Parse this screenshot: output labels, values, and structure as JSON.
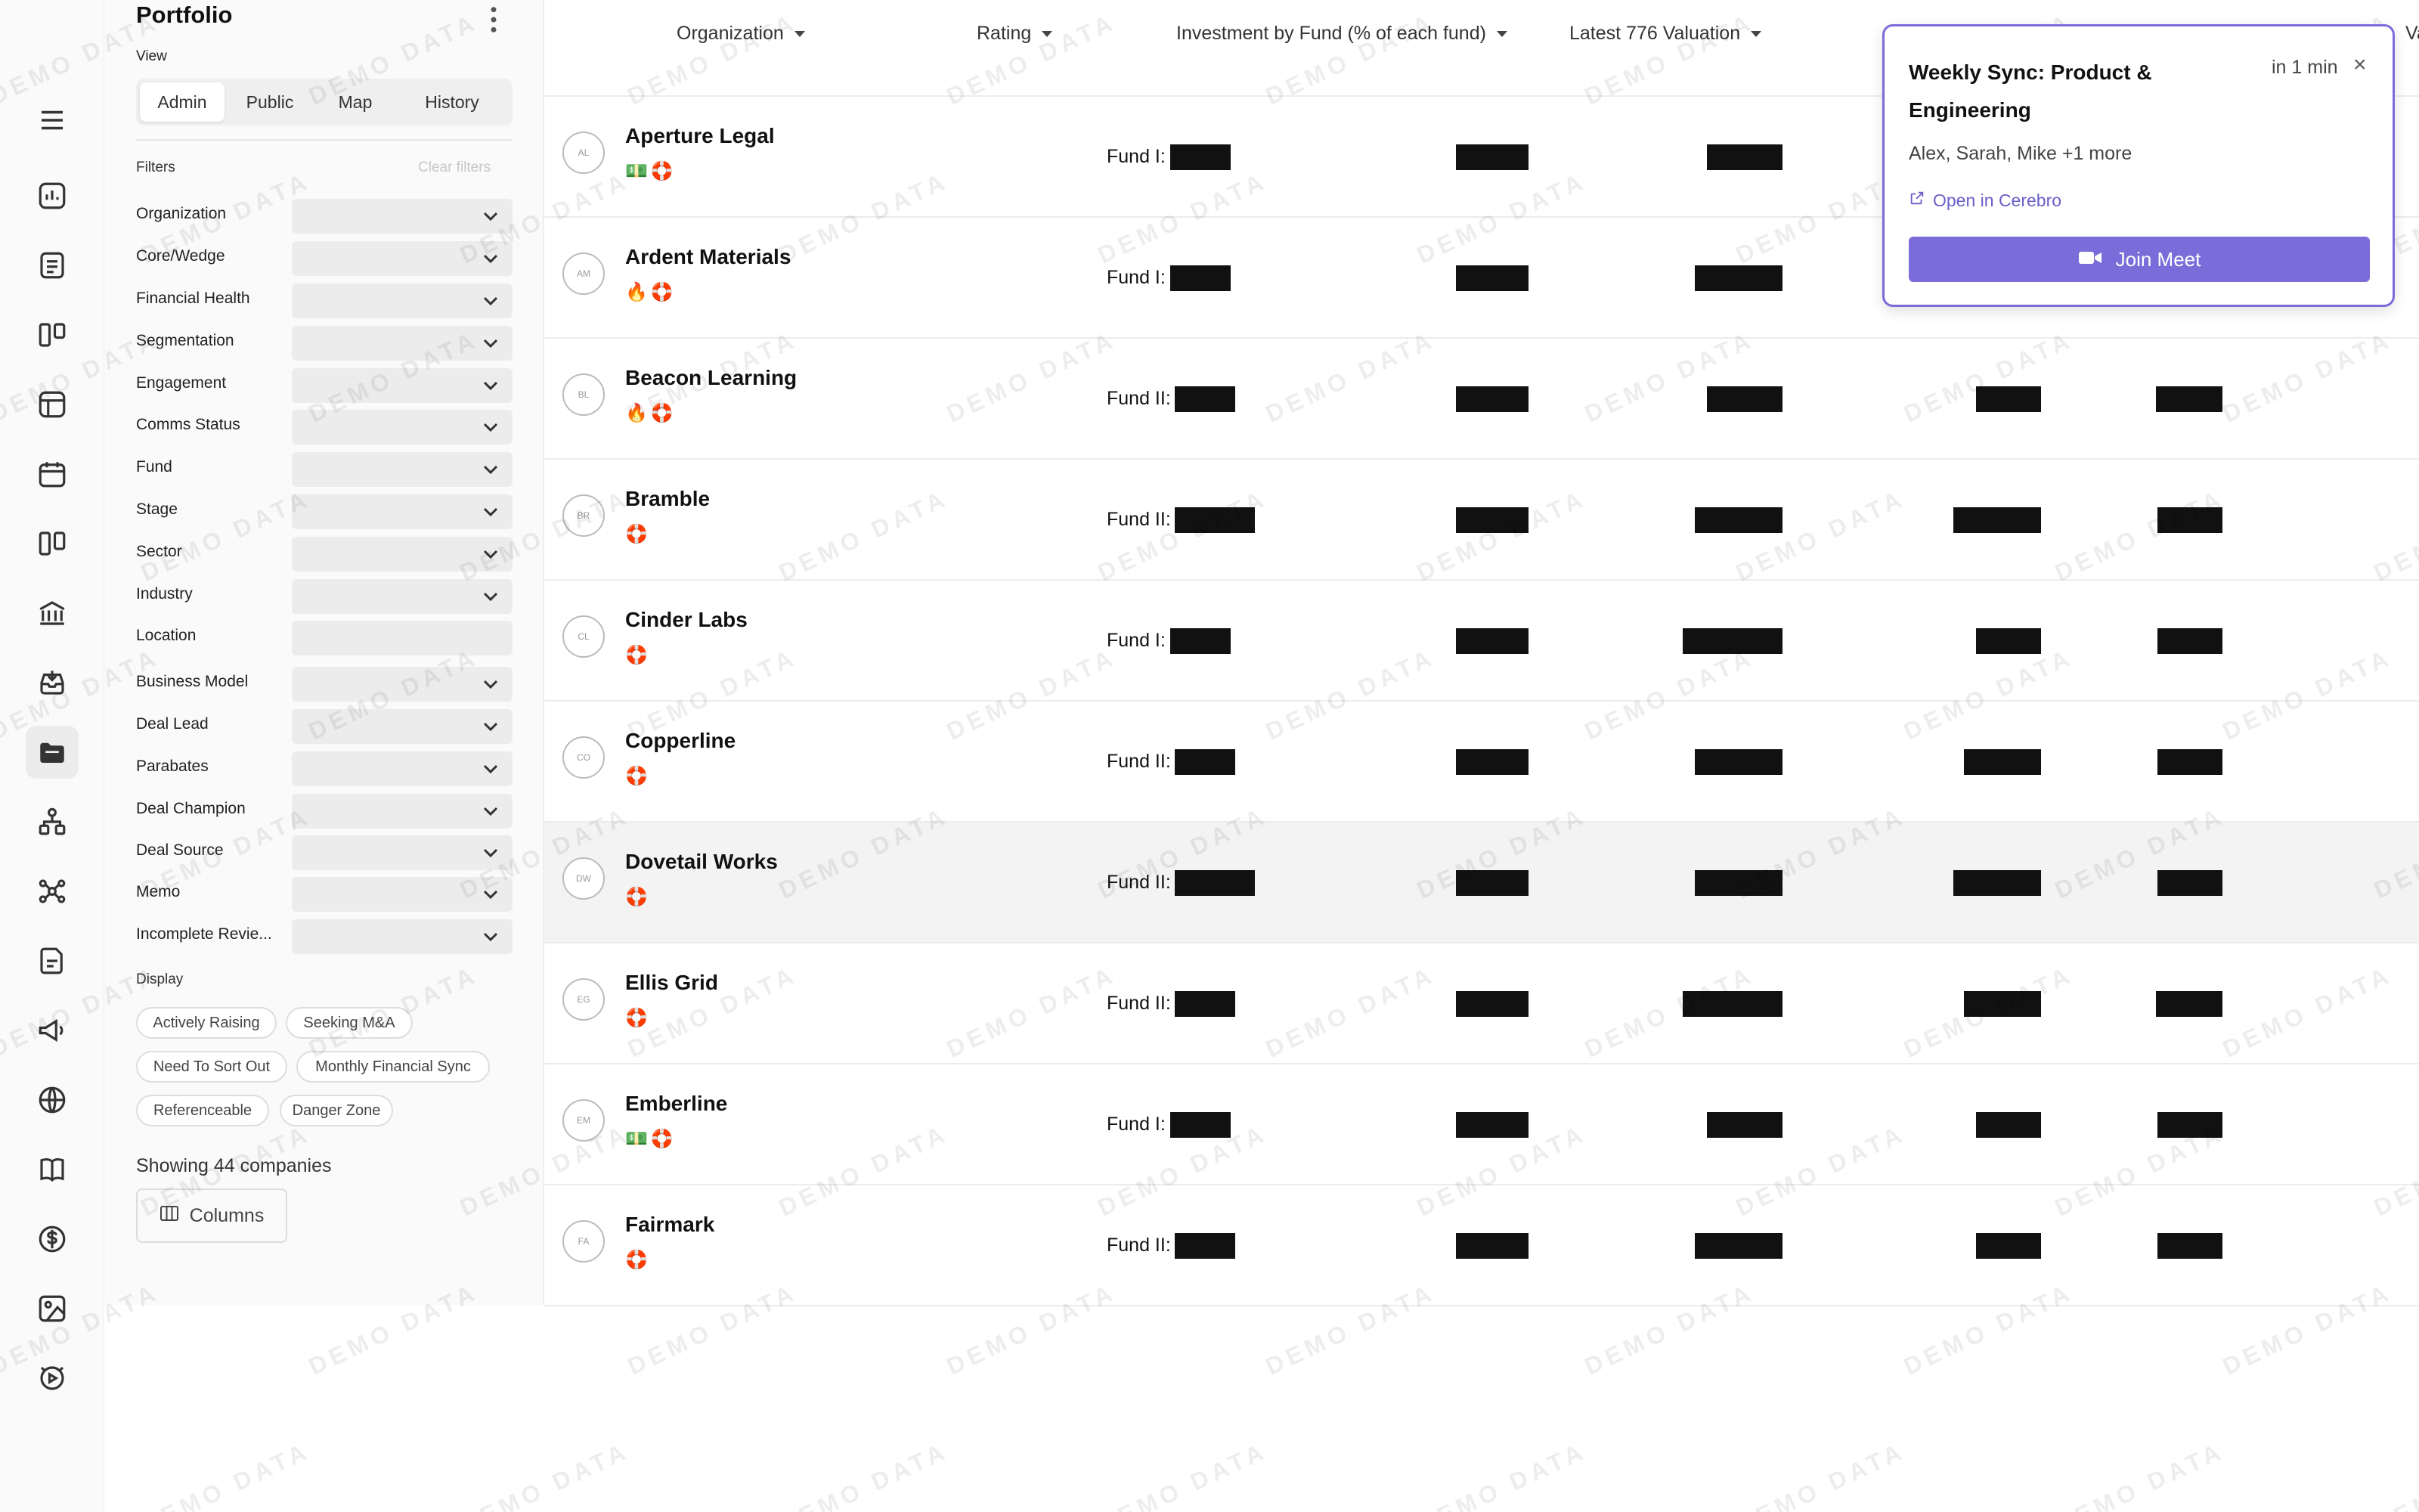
{
  "sidebar": {
    "title": "Portfolio",
    "view_label": "View",
    "views": [
      "Admin",
      "Public",
      "Map",
      "History"
    ],
    "active_view": "Admin",
    "filters_label": "Filters",
    "clear_filters": "Clear filters",
    "filters": [
      "Organization",
      "Core/Wedge",
      "Financial Health",
      "Segmentation",
      "Engagement",
      "Comms Status",
      "Fund",
      "Stage",
      "Sector",
      "Industry",
      "Location",
      "Business Model",
      "Deal Lead",
      "Parabates",
      "Deal Champion",
      "Deal Source",
      "Memo",
      "Incomplete Revie..."
    ],
    "display_label": "Display",
    "display_chips": [
      "Actively Raising",
      "Seeking M&A",
      "Need To Sort Out",
      "Monthly Financial Sync",
      "Referenceable",
      "Danger Zone"
    ],
    "showing": "Showing 44 companies",
    "columns_button": "Columns"
  },
  "table": {
    "headers": [
      "Organization",
      "Rating",
      "Investment by Fund (% of each fund)",
      "Latest 776 Valuation",
      "Val"
    ],
    "rows": [
      {
        "initials": "AL",
        "name": "Aperture Legal",
        "tags": "💵🛟",
        "fund": "Fund I:"
      },
      {
        "initials": "AM",
        "name": "Ardent Materials",
        "tags": "🔥🛟",
        "fund": "Fund I:"
      },
      {
        "initials": "BL",
        "name": "Beacon Learning",
        "tags": "🔥🛟",
        "fund": "Fund II:"
      },
      {
        "initials": "BR",
        "name": "Bramble",
        "tags": "🛟",
        "fund": "Fund II:"
      },
      {
        "initials": "CL",
        "name": "Cinder Labs",
        "tags": "🛟",
        "fund": "Fund I:"
      },
      {
        "initials": "CO",
        "name": "Copperline",
        "tags": "🛟",
        "fund": "Fund II:"
      },
      {
        "initials": "DW",
        "name": "Dovetail Works",
        "tags": "🛟",
        "fund": "Fund II:"
      },
      {
        "initials": "EG",
        "name": "Ellis Grid",
        "tags": "🛟",
        "fund": "Fund II:"
      },
      {
        "initials": "EM",
        "name": "Emberline",
        "tags": "💵🛟",
        "fund": "Fund I:"
      },
      {
        "initials": "FA",
        "name": "Fairmark",
        "tags": "🛟",
        "fund": "Fund II:"
      }
    ]
  },
  "meeting": {
    "title": "Weekly Sync: Product & Engineering",
    "time": "in 1 min",
    "people": "Alex, Sarah, Mike +1 more",
    "link": "Open in Cerebro",
    "join": "Join Meet",
    "accent": "#7b6dd9"
  },
  "watermark_text": "DEMO DATA",
  "icons": [
    "menu-icon",
    "analytics-icon",
    "notes-icon",
    "board-icon",
    "dashboard-icon",
    "calendar-icon",
    "kanban-icon",
    "bank-icon",
    "inbox-icon",
    "portfolio-icon",
    "hierarchy-icon",
    "network-icon",
    "document-icon",
    "megaphone-icon",
    "globe-icon",
    "book-icon",
    "dollar-icon",
    "image-icon",
    "media-icon"
  ]
}
